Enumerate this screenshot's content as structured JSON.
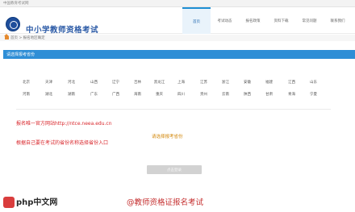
{
  "top_strip": {
    "text": "中国教育考试网"
  },
  "header": {
    "logo_text": "中小学教师资格考试"
  },
  "nav": {
    "items": [
      "首页",
      "考试动态",
      "报名政策",
      "资料下载",
      "常见问题",
      "联系我们"
    ]
  },
  "breadcrumb": {
    "home": "首页",
    "separator": ">",
    "current": "报名地区确定"
  },
  "section_bar": {
    "text": "请选择报考省份"
  },
  "provinces": [
    "北京",
    "天津",
    "河北",
    "山西",
    "辽宁",
    "吉林",
    "黑龙江",
    "上海",
    "江苏",
    "浙江",
    "安徽",
    "福建",
    "江西",
    "山东",
    "河南",
    "湖北",
    "湖南",
    "广东",
    "广西",
    "海南",
    "重庆",
    "四川",
    "贵州",
    "云南",
    "陕西",
    "甘肃",
    "青海",
    "宁夏"
  ],
  "notes": {
    "official_site": "报名唯一官方网站http://ntce.neea.edu.cn",
    "instruction": "根据自己要在考试的省份名称选择省份入口",
    "choose_prompt": "请选择报考省份"
  },
  "button": {
    "label": "点击登录"
  },
  "watermark": {
    "site": "php中文网",
    "caption": "@教师资格证报名考试"
  }
}
